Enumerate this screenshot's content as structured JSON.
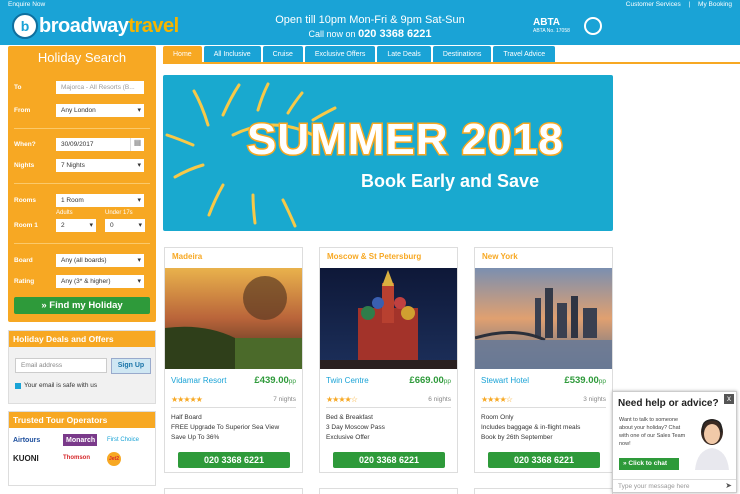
{
  "topbar": {
    "enquire": "Enquire Now",
    "customer_services": "Customer Services",
    "sep": "|",
    "my_booking": "My Booking"
  },
  "header": {
    "logo_letter": "b",
    "logo_text_a": "broadway",
    "logo_text_b": "travel",
    "open_text": "Open till 10pm Mon-Fri & 9pm Sat-Sun",
    "call_label": "Call now on",
    "phone": "020 3368 6221",
    "abta": "ABTA",
    "abta_no": "ABTA No. 17058"
  },
  "nav": [
    "Home",
    "All Inclusive",
    "Cruise",
    "Exclusive Offers",
    "Late Deals",
    "Destinations",
    "Travel Advice"
  ],
  "search": {
    "title": "Holiday Search",
    "to_label": "To",
    "to_placeholder": "Majorca - All Resorts (B...",
    "from_label": "From",
    "from_value": "Any London",
    "when_label": "When?",
    "when_value": "30/09/2017",
    "nights_label": "Nights",
    "nights_value": "7 Nights",
    "rooms_label": "Rooms",
    "rooms_value": "1 Room",
    "adults_label": "Adults",
    "under17_label": "Under 17s",
    "room1_label": "Room 1",
    "adults_value": "2",
    "children_value": "0",
    "board_label": "Board",
    "board_value": "Any (all boards)",
    "rating_label": "Rating",
    "rating_value": "Any (3* & higher)",
    "button": "» Find my Holiday"
  },
  "deals": {
    "title": "Holiday Deals and Offers",
    "email_placeholder": "Email address",
    "signup": "Sign Up",
    "safe": "Your email is safe with us"
  },
  "tour": {
    "title": "Trusted Tour Operators",
    "operators": [
      "Airtours",
      "Monarch",
      "First Choice",
      "KUONI",
      "Thomson",
      "Jet2"
    ]
  },
  "banner": {
    "title": "SUMMER 2018",
    "subtitle": "Book Early and Save"
  },
  "cards": [
    {
      "place": "Madeira",
      "hotel": "Vidamar Resort",
      "price": "£439.00",
      "pp": "pp",
      "stars": "★★★★★",
      "nights": "7 nights",
      "f1": "Half Board",
      "f2": "FREE Upgrade To Superior Sea View",
      "f3": "Save Up To 36%",
      "phone": "020 3368 6221"
    },
    {
      "place": "Moscow & St Petersburg",
      "hotel": "Twin Centre",
      "price": "£669.00",
      "pp": "pp",
      "stars": "★★★★☆",
      "nights": "6 nights",
      "f1": "Bed & Breakfast",
      "f2": "3 Day Moscow Pass",
      "f3": "Exclusive Offer",
      "phone": "020 3368 6221"
    },
    {
      "place": "New York",
      "hotel": "Stewart Hotel",
      "price": "£539.00",
      "pp": "pp",
      "stars": "★★★★☆",
      "nights": "3 nights",
      "f1": "Room Only",
      "f2": "Includes baggage & in-flight meals",
      "f3": "Book by 26th September",
      "phone": "020 3368 6221"
    }
  ],
  "help": {
    "title": "Need help or advice?",
    "text": "Want to talk to someone about your holiday? Chat with one of our Sales Team now!",
    "chat": "» Click to chat",
    "placeholder": "Type your message here",
    "close": "x"
  }
}
